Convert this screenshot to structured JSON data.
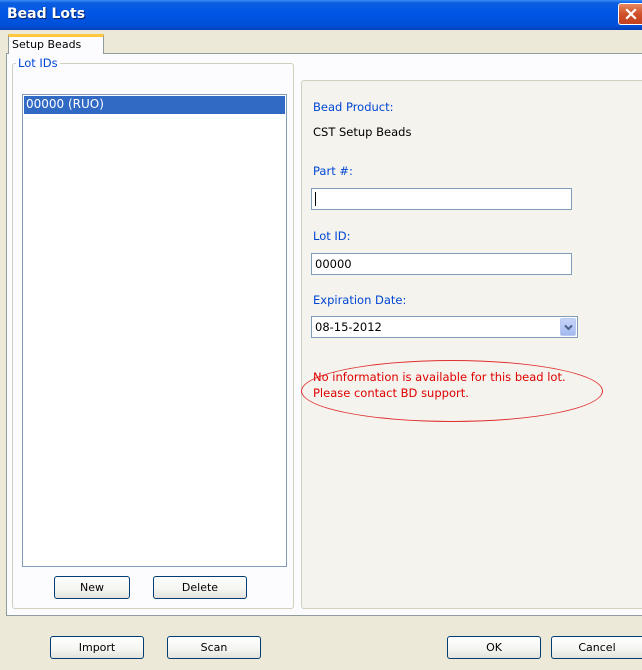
{
  "window": {
    "title": "Bead Lots"
  },
  "tabs": [
    {
      "label": "Setup Beads"
    }
  ],
  "lot_ids": {
    "group_label": "Lot IDs",
    "items": [
      {
        "label": "00000 (RUO)",
        "selected": true
      }
    ],
    "new_label": "New",
    "delete_label": "Delete"
  },
  "details": {
    "bead_product_label": "Bead Product:",
    "bead_product_value": "CST Setup Beads",
    "part_label": "Part #:",
    "part_value": "",
    "lot_id_label": "Lot ID:",
    "lot_id_value": "00000",
    "expiration_label": "Expiration Date:",
    "expiration_value": "08-15-2012",
    "error_message": "No information is available for this bead lot.\nPlease contact BD support.",
    "error_color": "#e00000"
  },
  "footer": {
    "import_label": "Import",
    "scan_label": "Scan",
    "ok_label": "OK",
    "cancel_label": "Cancel"
  },
  "colors": {
    "titlebar": "#0055e5",
    "selection": "#316ac5",
    "label_blue": "#0046d5",
    "tab_highlight": "#ffc83c"
  },
  "icons": {
    "close": "close-icon",
    "combo": "chevron-down-icon"
  }
}
